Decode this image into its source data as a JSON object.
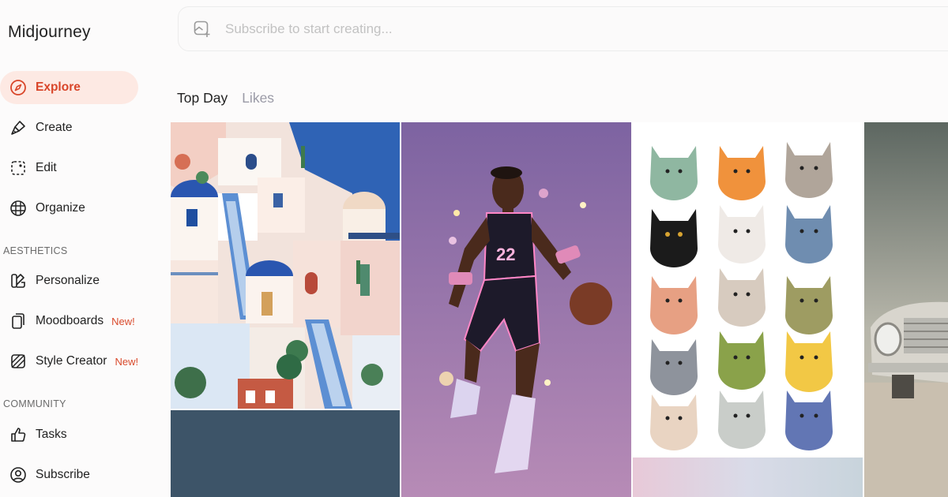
{
  "app": {
    "brand": "Midjourney"
  },
  "search": {
    "placeholder": "Subscribe to start creating..."
  },
  "nav": {
    "items": [
      {
        "label": "Explore"
      },
      {
        "label": "Create"
      },
      {
        "label": "Edit"
      },
      {
        "label": "Organize"
      }
    ],
    "sections": {
      "aesthetics": {
        "title": "AESTHETICS",
        "items": [
          {
            "label": "Personalize",
            "badge": ""
          },
          {
            "label": "Moodboards",
            "badge": "New!"
          },
          {
            "label": "Style Creator",
            "badge": "New!"
          }
        ]
      },
      "community": {
        "title": "COMMUNITY",
        "items": [
          {
            "label": "Tasks"
          },
          {
            "label": "Subscribe"
          }
        ]
      }
    }
  },
  "tabs": [
    {
      "label": "Top Day",
      "active": true
    },
    {
      "label": "Likes",
      "active": false
    }
  ],
  "colors": {
    "accent": "#d9462a",
    "active_bg": "#fde9e3",
    "muted_tab": "#9a9aa6"
  },
  "icons": {
    "explore": "compass-icon",
    "create": "brush-icon",
    "edit": "edit-frame-icon",
    "organize": "grid-icon",
    "personalize": "palette-icon",
    "moodboards": "cards-icon",
    "style_creator": "style-icon",
    "tasks": "thumbs-up-icon",
    "subscribe": "user-circle-icon",
    "search": "add-image-icon"
  }
}
